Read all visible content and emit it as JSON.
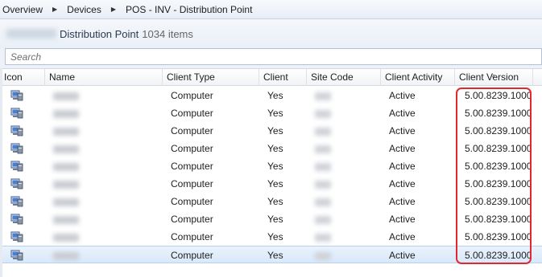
{
  "breadcrumb": {
    "items": [
      "Overview",
      "Devices",
      "POS - INV - Distribution Point"
    ]
  },
  "title": {
    "text": "Distribution Point",
    "count": "1034 items"
  },
  "search": {
    "placeholder": "Search",
    "value": ""
  },
  "table": {
    "columns": [
      "Icon",
      "Name",
      "Client Type",
      "Client",
      "Site Code",
      "Client Activity",
      "Client Version"
    ],
    "sorted_column": "Client Version",
    "rows": [
      {
        "client_type": "Computer",
        "client": "Yes",
        "activity": "Active",
        "version": "5.00.8239.1000",
        "selected": false
      },
      {
        "client_type": "Computer",
        "client": "Yes",
        "activity": "Active",
        "version": "5.00.8239.1000",
        "selected": false
      },
      {
        "client_type": "Computer",
        "client": "Yes",
        "activity": "Active",
        "version": "5.00.8239.1000",
        "selected": false
      },
      {
        "client_type": "Computer",
        "client": "Yes",
        "activity": "Active",
        "version": "5.00.8239.1000",
        "selected": false
      },
      {
        "client_type": "Computer",
        "client": "Yes",
        "activity": "Active",
        "version": "5.00.8239.1000",
        "selected": false
      },
      {
        "client_type": "Computer",
        "client": "Yes",
        "activity": "Active",
        "version": "5.00.8239.1000",
        "selected": false
      },
      {
        "client_type": "Computer",
        "client": "Yes",
        "activity": "Active",
        "version": "5.00.8239.1000",
        "selected": false
      },
      {
        "client_type": "Computer",
        "client": "Yes",
        "activity": "Active",
        "version": "5.00.8239.1000",
        "selected": false
      },
      {
        "client_type": "Computer",
        "client": "Yes",
        "activity": "Active",
        "version": "5.00.8239.1000",
        "selected": false
      },
      {
        "client_type": "Computer",
        "client": "Yes",
        "activity": "Active",
        "version": "5.00.8239.1000",
        "selected": true
      }
    ]
  },
  "icons": {
    "breadcrumb_separator": "triangle-right-icon",
    "row_icon": "computer-icon",
    "sort": "sort-ascending-icon"
  },
  "colors": {
    "highlight": "#e0282e",
    "selected_row": "#d9e8f9"
  }
}
